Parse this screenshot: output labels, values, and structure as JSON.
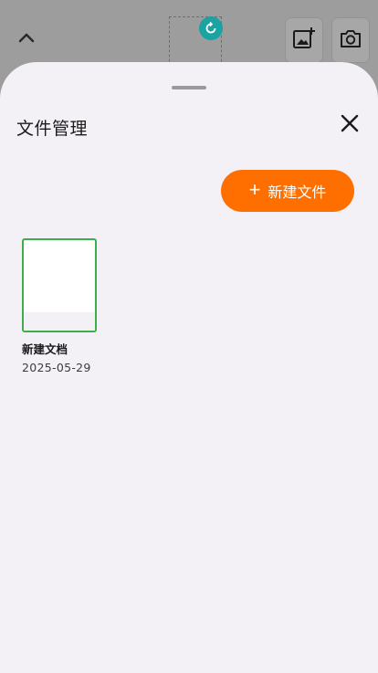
{
  "sheet": {
    "title": "文件管理",
    "new_file_label": "新建文件"
  },
  "files": [
    {
      "name": "新建文档",
      "date": "2025-05-29"
    }
  ],
  "icons": {
    "chevron": "chevron-up-icon",
    "rotate": "rotate-icon",
    "add_image": "add-image-icon",
    "camera": "camera-icon",
    "close": "close-icon",
    "plus": "plus-icon"
  },
  "colors": {
    "accent": "#ff6f00",
    "selected_border": "#3fae4a",
    "rotate_handle": "#1aa3a3",
    "sheet_bg": "#f3f1f5"
  }
}
